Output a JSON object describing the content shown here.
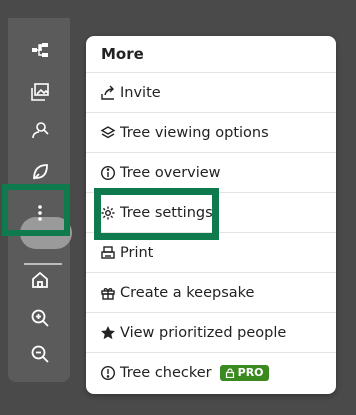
{
  "rail": {
    "tools": [
      {
        "icon": "tree-structure-icon"
      },
      {
        "icon": "media-gallery-icon"
      },
      {
        "icon": "search-person-icon"
      },
      {
        "icon": "leaf-hint-icon"
      },
      {
        "icon": "more-vertical-icon"
      },
      {
        "icon": "home-icon"
      },
      {
        "icon": "zoom-in-icon"
      },
      {
        "icon": "zoom-out-icon"
      }
    ]
  },
  "menu": {
    "title": "More",
    "items": [
      {
        "label": "Invite",
        "icon": "share-icon"
      },
      {
        "label": "Tree viewing options",
        "icon": "layers-icon"
      },
      {
        "label": "Tree overview",
        "icon": "info-icon"
      },
      {
        "label": "Tree settings",
        "icon": "gear-icon"
      },
      {
        "label": "Print",
        "icon": "print-icon"
      },
      {
        "label": "Create a keepsake",
        "icon": "gift-icon"
      },
      {
        "label": "View prioritized people",
        "icon": "star-icon"
      },
      {
        "label": "Tree checker",
        "icon": "alert-circle-icon",
        "badge": "PRO"
      }
    ]
  },
  "colors": {
    "highlight": "#0f7a4e",
    "pro_badge": "#3a8a1f",
    "rail_bg": "#5b5b5b",
    "page_bg": "#4a4a4a"
  }
}
